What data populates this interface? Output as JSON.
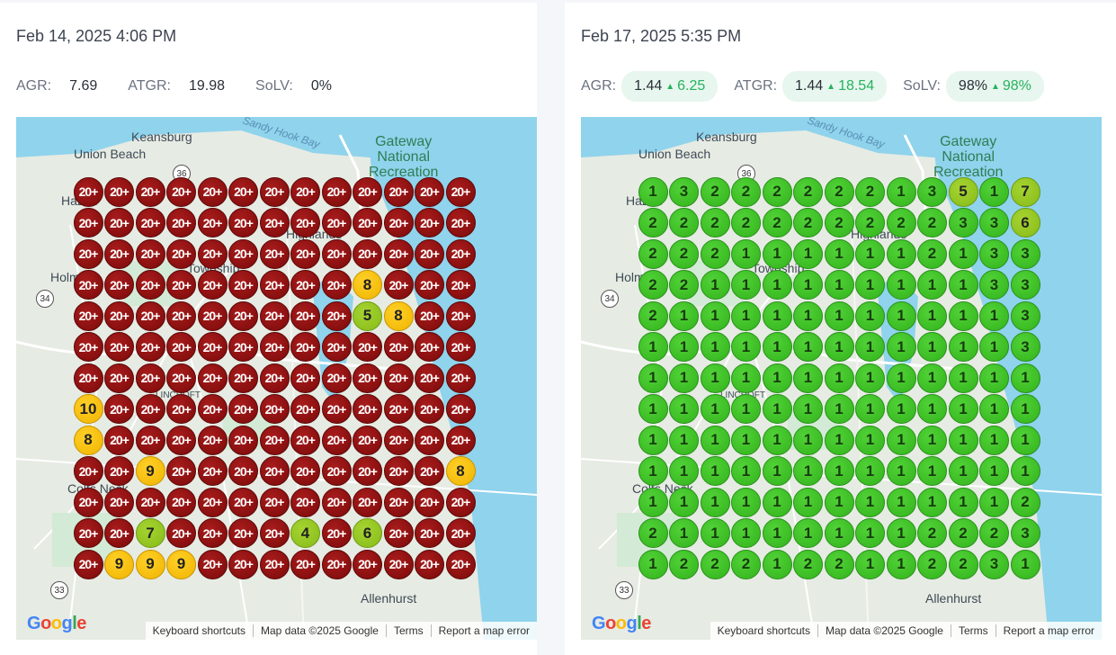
{
  "brand": {
    "google_logo": "Google"
  },
  "panels": [
    {
      "date": "Feb 14, 2025 4:06 PM",
      "metrics": {
        "agr_label": "AGR:",
        "agr_value": "7.69",
        "atgr_label": "ATGR:",
        "atgr_value": "19.98",
        "solv_label": "SoLV:",
        "solv_value": "0%"
      },
      "grid": [
        [
          "20+",
          "20+",
          "20+",
          "20+",
          "20+",
          "20+",
          "20+",
          "20+",
          "20+",
          "20+",
          "20+",
          "20+",
          "20+"
        ],
        [
          "20+",
          "20+",
          "20+",
          "20+",
          "20+",
          "20+",
          "20+",
          "20+",
          "20+",
          "20+",
          "20+",
          "20+",
          "20+"
        ],
        [
          "20+",
          "20+",
          "20+",
          "20+",
          "20+",
          "20+",
          "20+",
          "20+",
          "20+",
          "20+",
          "20+",
          "20+",
          "20+"
        ],
        [
          "20+",
          "20+",
          "20+",
          "20+",
          "20+",
          "20+",
          "20+",
          "20+",
          "20+",
          "8",
          "20+",
          "20+",
          "20+"
        ],
        [
          "20+",
          "20+",
          "20+",
          "20+",
          "20+",
          "20+",
          "20+",
          "20+",
          "20+",
          "5",
          "8",
          "20+",
          "20+"
        ],
        [
          "20+",
          "20+",
          "20+",
          "20+",
          "20+",
          "20+",
          "20+",
          "20+",
          "20+",
          "20+",
          "20+",
          "20+",
          "20+"
        ],
        [
          "20+",
          "20+",
          "20+",
          "20+",
          "20+",
          "20+",
          "20+",
          "20+",
          "20+",
          "20+",
          "20+",
          "20+",
          "20+"
        ],
        [
          "10",
          "20+",
          "20+",
          "20+",
          "20+",
          "20+",
          "20+",
          "20+",
          "20+",
          "20+",
          "20+",
          "20+",
          "20+"
        ],
        [
          "8",
          "20+",
          "20+",
          "20+",
          "20+",
          "20+",
          "20+",
          "20+",
          "20+",
          "20+",
          "20+",
          "20+",
          "20+"
        ],
        [
          "20+",
          "20+",
          "9",
          "20+",
          "20+",
          "20+",
          "20+",
          "20+",
          "20+",
          "20+",
          "20+",
          "20+",
          "8"
        ],
        [
          "20+",
          "20+",
          "20+",
          "20+",
          "20+",
          "20+",
          "20+",
          "20+",
          "20+",
          "20+",
          "20+",
          "20+",
          "20+"
        ],
        [
          "20+",
          "20+",
          "7",
          "20+",
          "20+",
          "20+",
          "20+",
          "4",
          "20+",
          "6",
          "20+",
          "20+",
          "20+"
        ],
        [
          "20+",
          "9",
          "9",
          "9",
          "20+",
          "20+",
          "20+",
          "20+",
          "20+",
          "20+",
          "20+",
          "20+",
          "20+"
        ]
      ]
    },
    {
      "date": "Feb 17, 2025 5:35 PM",
      "metrics": {
        "agr_label": "AGR:",
        "agr_value": "1.44",
        "agr_delta": "6.25",
        "atgr_label": "ATGR:",
        "atgr_value": "1.44",
        "atgr_delta": "18.54",
        "solv_label": "SoLV:",
        "solv_value": "98%",
        "solv_delta": "98%"
      },
      "grid": [
        [
          "1",
          "3",
          "2",
          "2",
          "2",
          "2",
          "2",
          "2",
          "1",
          "3",
          "5",
          "1",
          "7"
        ],
        [
          "2",
          "2",
          "2",
          "2",
          "2",
          "2",
          "2",
          "2",
          "2",
          "2",
          "3",
          "3",
          "6"
        ],
        [
          "2",
          "2",
          "2",
          "1",
          "1",
          "1",
          "1",
          "1",
          "1",
          "2",
          "1",
          "3",
          "3"
        ],
        [
          "2",
          "2",
          "1",
          "1",
          "1",
          "1",
          "1",
          "1",
          "1",
          "1",
          "1",
          "3",
          "3"
        ],
        [
          "2",
          "1",
          "1",
          "1",
          "1",
          "1",
          "1",
          "1",
          "1",
          "1",
          "1",
          "1",
          "3"
        ],
        [
          "1",
          "1",
          "1",
          "1",
          "1",
          "1",
          "1",
          "1",
          "1",
          "1",
          "1",
          "1",
          "3"
        ],
        [
          "1",
          "1",
          "1",
          "1",
          "1",
          "1",
          "1",
          "1",
          "1",
          "1",
          "1",
          "1",
          "1"
        ],
        [
          "1",
          "1",
          "1",
          "1",
          "1",
          "1",
          "1",
          "1",
          "1",
          "1",
          "1",
          "1",
          "1"
        ],
        [
          "1",
          "1",
          "1",
          "1",
          "1",
          "1",
          "1",
          "1",
          "1",
          "1",
          "1",
          "1",
          "1"
        ],
        [
          "1",
          "1",
          "1",
          "1",
          "1",
          "1",
          "1",
          "1",
          "1",
          "1",
          "1",
          "1",
          "1"
        ],
        [
          "1",
          "1",
          "1",
          "1",
          "1",
          "1",
          "1",
          "1",
          "1",
          "1",
          "1",
          "1",
          "2"
        ],
        [
          "2",
          "1",
          "1",
          "1",
          "1",
          "1",
          "1",
          "1",
          "1",
          "2",
          "2",
          "2",
          "3"
        ],
        [
          "1",
          "2",
          "2",
          "2",
          "1",
          "2",
          "2",
          "1",
          "1",
          "2",
          "2",
          "3",
          "1"
        ]
      ]
    }
  ],
  "map": {
    "labels": {
      "keansburg": "Keansburg",
      "union_beach": "Union Beach",
      "sandy_hook_bay": "Sandy Hook Bay",
      "gateway": "Gateway",
      "national": "National",
      "recreation": "Recreation",
      "allenhurst": "Allenhurst",
      "hazlet": "Hazlet",
      "holmdel": "Holmdel",
      "colts_neck": "Colts Neck",
      "highlands": "Highlands",
      "township": "Township",
      "lincroft": "LINCROFT"
    },
    "shields": {
      "r36": "36",
      "r34": "34",
      "r33": "33"
    },
    "attribution": {
      "keyboard": "Keyboard shortcuts",
      "mapdata": "Map data ©2025 Google",
      "terms": "Terms",
      "report": "Report a map error"
    }
  },
  "colors": {
    "red": "#8b1010",
    "yellow": "#f7c10f",
    "lime": "#96c820",
    "green": "#42c32a",
    "water": "#8fd3ec",
    "delta_green": "#26b35e"
  }
}
